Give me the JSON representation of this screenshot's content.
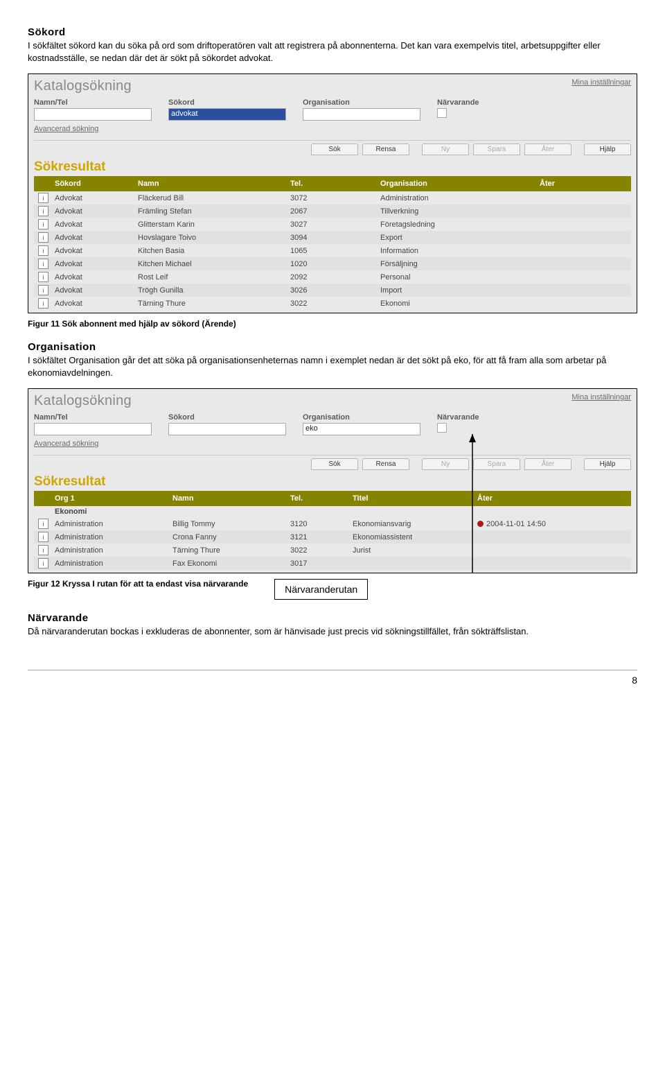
{
  "section1": {
    "title": "Sökord",
    "para": "I sökfältet sökord kan du söka på ord som driftoperatören valt att registrera på abonnenterna. Det kan vara exempelvis titel, arbetsuppgifter eller kostnadsställe, se nedan där det är sökt på sökordet advokat."
  },
  "app": {
    "moduleTitle": "Katalogsökning",
    "mysettings": "Mina inställningar",
    "labels": {
      "namntel": "Namn/Tel",
      "sokord": "Sökord",
      "org": "Organisation",
      "narv": "Närvarande"
    },
    "adv": "Avancerad sökning",
    "btns": {
      "sok": "Sök",
      "rensa": "Rensa",
      "ny": "Ny",
      "spara": "Spara",
      "ater": "Åter",
      "hjalp": "Hjälp"
    },
    "resultTitle": "Sökresultat"
  },
  "fig1": {
    "sokordValue": "advokat",
    "headers": {
      "sokord": "Sökord",
      "namn": "Namn",
      "tel": "Tel.",
      "org": "Organisation",
      "ater": "Åter"
    },
    "rows": [
      {
        "sokord": "Advokat",
        "namn": "Fläckerud Bill",
        "tel": "3072",
        "org": "Administration"
      },
      {
        "sokord": "Advokat",
        "namn": "Främling Stefan",
        "tel": "2067",
        "org": "Tillverkning"
      },
      {
        "sokord": "Advokat",
        "namn": "Glitterstam Karin",
        "tel": "3027",
        "org": "Företagsledning"
      },
      {
        "sokord": "Advokat",
        "namn": "Hovslagare Toivo",
        "tel": "3094",
        "org": "Export"
      },
      {
        "sokord": "Advokat",
        "namn": "Kitchen Basia",
        "tel": "1065",
        "org": "Information"
      },
      {
        "sokord": "Advokat",
        "namn": "Kitchen Michael",
        "tel": "1020",
        "org": "Försäljning"
      },
      {
        "sokord": "Advokat",
        "namn": "Rost Leif",
        "tel": "2092",
        "org": "Personal"
      },
      {
        "sokord": "Advokat",
        "namn": "Trögh Gunilla",
        "tel": "3026",
        "org": "Import"
      },
      {
        "sokord": "Advokat",
        "namn": "Tärning Thure",
        "tel": "3022",
        "org": "Ekonomi"
      }
    ],
    "caption": "Figur 11  Sök abonnent med hjälp av sökord (Ärende)"
  },
  "section2": {
    "title": "Organisation",
    "para": "I sökfältet Organisation går det att söka på organisationsenheternas namn i exemplet nedan är det sökt på eko, för att få fram alla som arbetar på ekonomiavdelningen."
  },
  "fig2": {
    "orgValue": "eko",
    "headers": {
      "org": "Org 1",
      "namn": "Namn",
      "tel": "Tel.",
      "titel": "Titel",
      "ater": "Åter"
    },
    "group": "Ekonomi",
    "rows": [
      {
        "org": "Administration",
        "namn": "Billig Tommy",
        "tel": "3120",
        "titel": "Ekonomiansvarig",
        "ater": "2004-11-01 14:50",
        "dot": true
      },
      {
        "org": "Administration",
        "namn": "Crona Fanny",
        "tel": "3121",
        "titel": "Ekonomiassistent"
      },
      {
        "org": "Administration",
        "namn": "Tärning Thure",
        "tel": "3022",
        "titel": "Jurist"
      },
      {
        "org": "Administration",
        "namn": "Fax Ekonomi",
        "tel": "3017",
        "titel": ""
      }
    ],
    "caption": "Figur 12  Kryssa I rutan för att ta endast visa närvarande",
    "nvbox": "Närvaranderutan"
  },
  "section3": {
    "title": "Närvarande",
    "para": "Då närvaranderutan bockas i exkluderas de abonnenter, som är hänvisade just precis vid sökningstillfället, från sökträffslistan."
  },
  "pagenum": "8"
}
